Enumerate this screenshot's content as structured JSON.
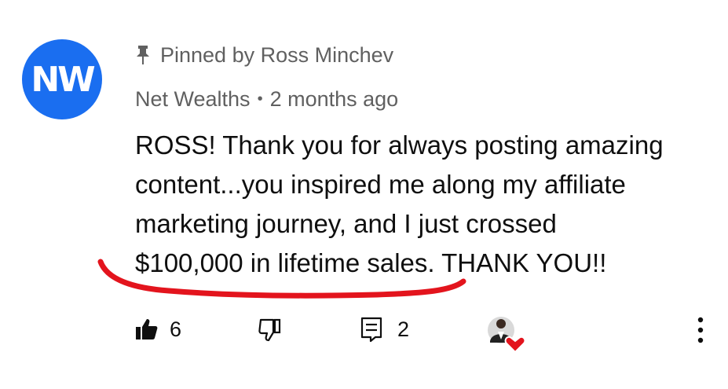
{
  "comment": {
    "avatar_text": "NW",
    "avatar_color": "#1a6ef0",
    "pinned_text": "Pinned by Ross Minchev",
    "author": "Net Wealths",
    "separator": "•",
    "timestamp": "2 months ago",
    "body_lines": [
      "ROSS! Thank you for always posting amazing",
      "content...you inspired me along my affiliate",
      "marketing journey, and I just crossed",
      "$100,000 in lifetime sales. THANK YOU!!"
    ],
    "highlight_color": "#e3141d"
  },
  "actions": {
    "likes": "6",
    "replies": "2"
  },
  "icons": {
    "pin": "pin-icon",
    "like": "thumbs-up-icon",
    "dislike": "thumbs-down-icon",
    "reply": "reply-icon",
    "hearted": "creator-heart-icon",
    "more": "more-vertical-icon"
  }
}
